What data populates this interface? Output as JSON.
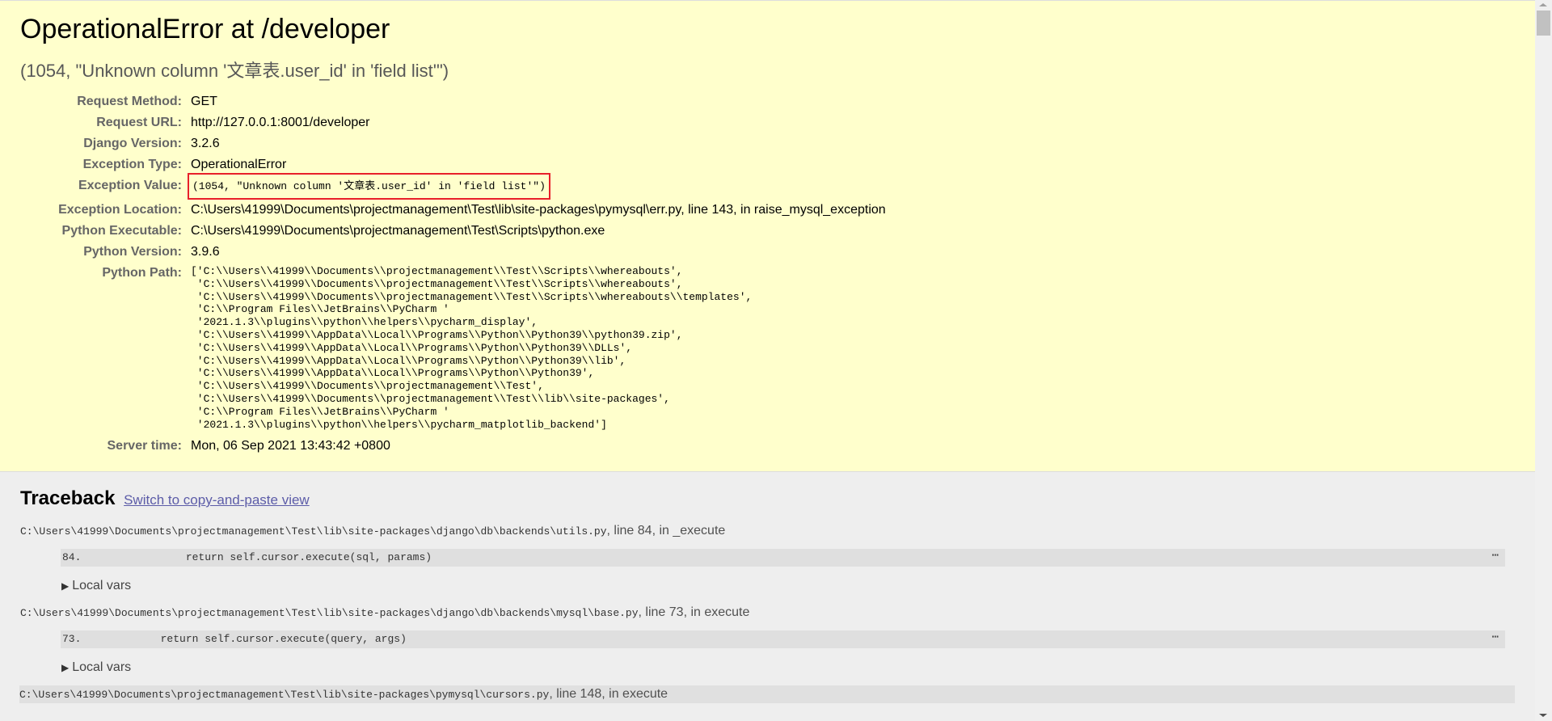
{
  "summary": {
    "title": "OperationalError at /developer",
    "subtitle": "(1054, \"Unknown column '文章表.user_id' in 'field list'\")",
    "rows": [
      {
        "label": "Request Method:",
        "value": "GET"
      },
      {
        "label": "Request URL:",
        "value": "http://127.0.0.1:8001/developer"
      },
      {
        "label": "Django Version:",
        "value": "3.2.6"
      },
      {
        "label": "Exception Type:",
        "value": "OperationalError"
      },
      {
        "label": "Exception Value:",
        "value": "(1054, \"Unknown column '文章表.user_id' in 'field list'\")"
      },
      {
        "label": "Exception Location:",
        "value": "C:\\Users\\41999\\Documents\\projectmanagement\\Test\\lib\\site-packages\\pymysql\\err.py, line 143, in raise_mysql_exception"
      },
      {
        "label": "Python Executable:",
        "value": "C:\\Users\\41999\\Documents\\projectmanagement\\Test\\Scripts\\python.exe"
      },
      {
        "label": "Python Version:",
        "value": "3.9.6"
      }
    ],
    "python_path_label": "Python Path:",
    "python_path": [
      "['C:\\\\Users\\\\41999\\\\Documents\\\\projectmanagement\\\\Test\\\\Scripts\\\\whereabouts',",
      " 'C:\\\\Users\\\\41999\\\\Documents\\\\projectmanagement\\\\Test\\\\Scripts\\\\whereabouts',",
      " 'C:\\\\Users\\\\41999\\\\Documents\\\\projectmanagement\\\\Test\\\\Scripts\\\\whereabouts\\\\templates',",
      " 'C:\\\\Program Files\\\\JetBrains\\\\PyCharm '",
      " '2021.1.3\\\\plugins\\\\python\\\\helpers\\\\pycharm_display',",
      " 'C:\\\\Users\\\\41999\\\\AppData\\\\Local\\\\Programs\\\\Python\\\\Python39\\\\python39.zip',",
      " 'C:\\\\Users\\\\41999\\\\AppData\\\\Local\\\\Programs\\\\Python\\\\Python39\\\\DLLs',",
      " 'C:\\\\Users\\\\41999\\\\AppData\\\\Local\\\\Programs\\\\Python\\\\Python39\\\\lib',",
      " 'C:\\\\Users\\\\41999\\\\AppData\\\\Local\\\\Programs\\\\Python\\\\Python39',",
      " 'C:\\\\Users\\\\41999\\\\Documents\\\\projectmanagement\\\\Test',",
      " 'C:\\\\Users\\\\41999\\\\Documents\\\\projectmanagement\\\\Test\\\\lib\\\\site-packages',",
      " 'C:\\\\Program Files\\\\JetBrains\\\\PyCharm '",
      " '2021.1.3\\\\plugins\\\\python\\\\helpers\\\\pycharm_matplotlib_backend']"
    ],
    "server_time_label": "Server time:",
    "server_time": "Mon, 06 Sep 2021 13:43:42 +0800",
    "highlight_color": "#e8202a"
  },
  "traceback": {
    "heading": "Traceback",
    "switch_link": "Switch to copy-and-paste view",
    "frames": [
      {
        "file": "C:\\Users\\41999\\Documents\\projectmanagement\\Test\\lib\\site-packages\\django\\db\\backends\\utils.py",
        "loc": ", line 84, in _execute",
        "line_no": "84.",
        "code": "                return self.cursor.execute(sql, params)",
        "ellipsis": "⋯",
        "local_vars": "Local vars"
      },
      {
        "file": "C:\\Users\\41999\\Documents\\projectmanagement\\Test\\lib\\site-packages\\django\\db\\backends\\mysql\\base.py",
        "loc": ", line 73, in execute",
        "line_no": "73.",
        "code": "            return self.cursor.execute(query, args)",
        "ellipsis": "⋯",
        "local_vars": "Local vars"
      },
      {
        "file": "C:\\Users\\41999\\Documents\\projectmanagement\\Test\\lib\\site-packages\\pymysql\\cursors.py",
        "loc": ", line 148, in execute"
      }
    ]
  }
}
